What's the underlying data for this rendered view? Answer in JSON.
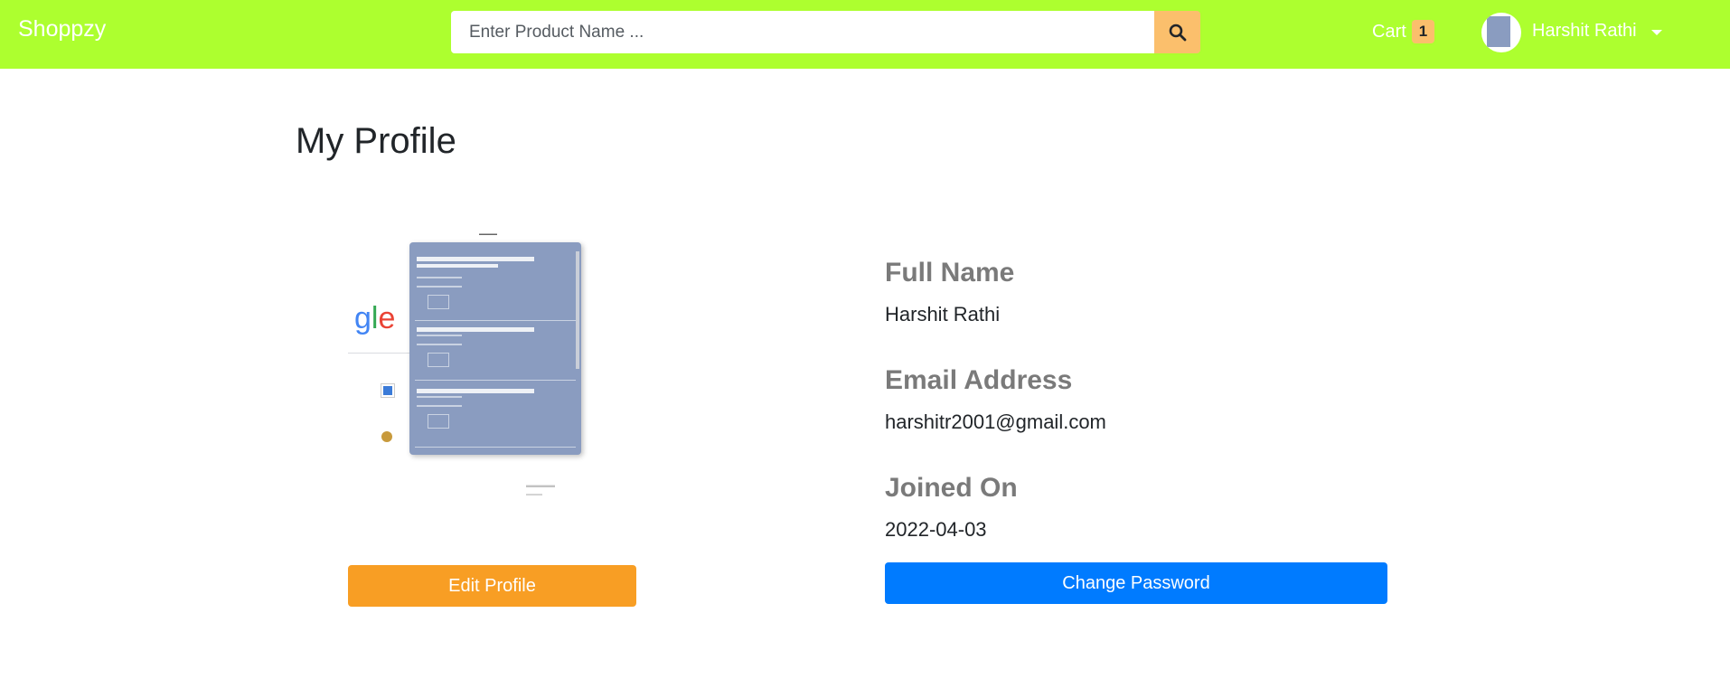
{
  "navbar": {
    "brand": "Shoppzy",
    "search": {
      "placeholder": "Enter Product Name ...",
      "button_icon": "search-icon"
    },
    "cart": {
      "label": "Cart",
      "count": "1"
    },
    "user": {
      "name": "Harshit Rathi"
    }
  },
  "page": {
    "title": "My Profile"
  },
  "profile": {
    "edit_label": "Edit Profile",
    "fields": [
      {
        "label": "Full Name",
        "value": "Harshit Rathi"
      },
      {
        "label": "Email Address",
        "value": "harshitr2001@gmail.com"
      },
      {
        "label": "Joined On",
        "value": "2022-04-03"
      }
    ],
    "change_password_label": "Change Password"
  },
  "colors": {
    "navbar_bg": "#adff2f",
    "search_button": "#fbbf6c",
    "edit_button": "#f89e24",
    "password_button": "#007bff"
  }
}
